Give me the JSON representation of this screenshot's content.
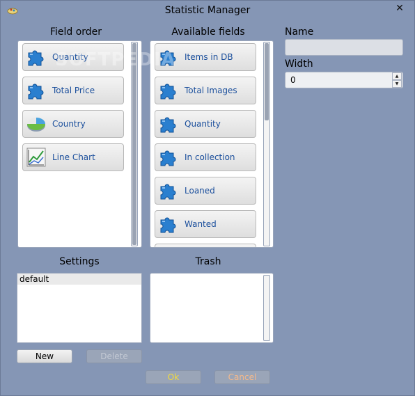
{
  "window": {
    "title": "Statistic Manager"
  },
  "field_order": {
    "heading": "Field order",
    "items": [
      {
        "label": "Quantity",
        "icon": "puzzle-icon"
      },
      {
        "label": "Total Price",
        "icon": "puzzle-icon"
      },
      {
        "label": "Country",
        "icon": "pie-chart-icon"
      },
      {
        "label": "Line Chart",
        "icon": "line-chart-icon"
      }
    ]
  },
  "available_fields": {
    "heading": "Available fields",
    "items": [
      {
        "label": "Items in DB",
        "icon": "puzzle-icon"
      },
      {
        "label": "Total Images",
        "icon": "puzzle-icon"
      },
      {
        "label": "Quantity",
        "icon": "puzzle-icon"
      },
      {
        "label": "In collection",
        "icon": "puzzle-icon"
      },
      {
        "label": "Loaned",
        "icon": "puzzle-icon"
      },
      {
        "label": "Wanted",
        "icon": "puzzle-icon"
      }
    ]
  },
  "properties": {
    "name_label": "Name",
    "name_value": "",
    "width_label": "Width",
    "width_value": "0"
  },
  "settings": {
    "heading": "Settings",
    "items": [
      "default"
    ]
  },
  "trash": {
    "heading": "Trash"
  },
  "buttons": {
    "new": "New",
    "delete": "Delete",
    "ok": "Ok",
    "cancel": "Cancel"
  },
  "watermark": "SOFTPEDIA",
  "colors": {
    "window_bg": "#8596b5",
    "field_label": "#1b4f9c",
    "ok_text": "#f4dc3a",
    "cancel_text": "#f5b98a"
  }
}
